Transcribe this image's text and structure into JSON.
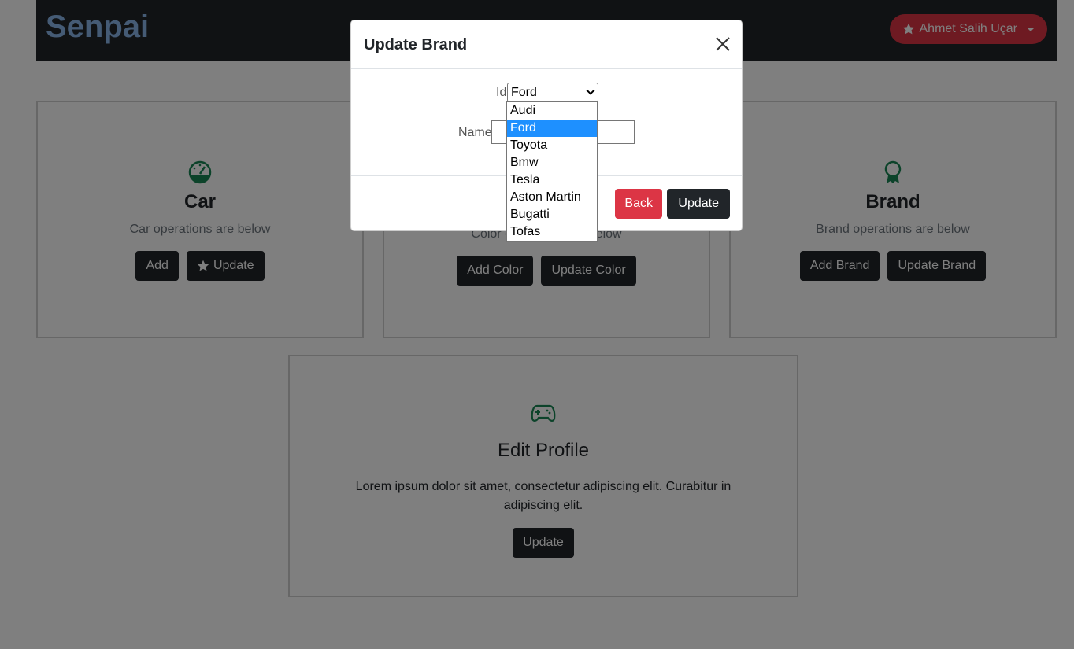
{
  "navbar": {
    "brand": "Senpai",
    "user_name": "Ahmet Salih Uçar"
  },
  "cards": {
    "car": {
      "title": "Car",
      "subtitle": "Car operations are below",
      "add_label": "Add",
      "update_label": "Update"
    },
    "color": {
      "subtitle": "Color operations are below",
      "add_label": "Add Color",
      "update_label": "Update Color"
    },
    "brand": {
      "title": "Brand",
      "subtitle": "Brand operations are below",
      "add_label": "Add Brand",
      "update_label": "Update Brand"
    },
    "profile": {
      "title": "Edit Profile",
      "text": "Lorem ipsum dolor sit amet, consectetur adipiscing elit. Curabitur in adipiscing elit.",
      "update_label": "Update"
    }
  },
  "modal": {
    "title": "Update Brand",
    "id_label": "Id",
    "selected": "Ford",
    "name_label": "Name",
    "name_value": "",
    "back_label": "Back",
    "update_label": "Update",
    "options": [
      "Audi",
      "Ford",
      "Toyota",
      "Bmw",
      "Tesla",
      "Aston Martin",
      "Bugatti",
      "Tofas"
    ],
    "selected_index": 1
  },
  "colors": {
    "icon_green": "#198754",
    "danger": "#dc3545",
    "dark": "#212529",
    "brand_blue": "#8ab6ea",
    "selected_option": "#1e90ff"
  }
}
